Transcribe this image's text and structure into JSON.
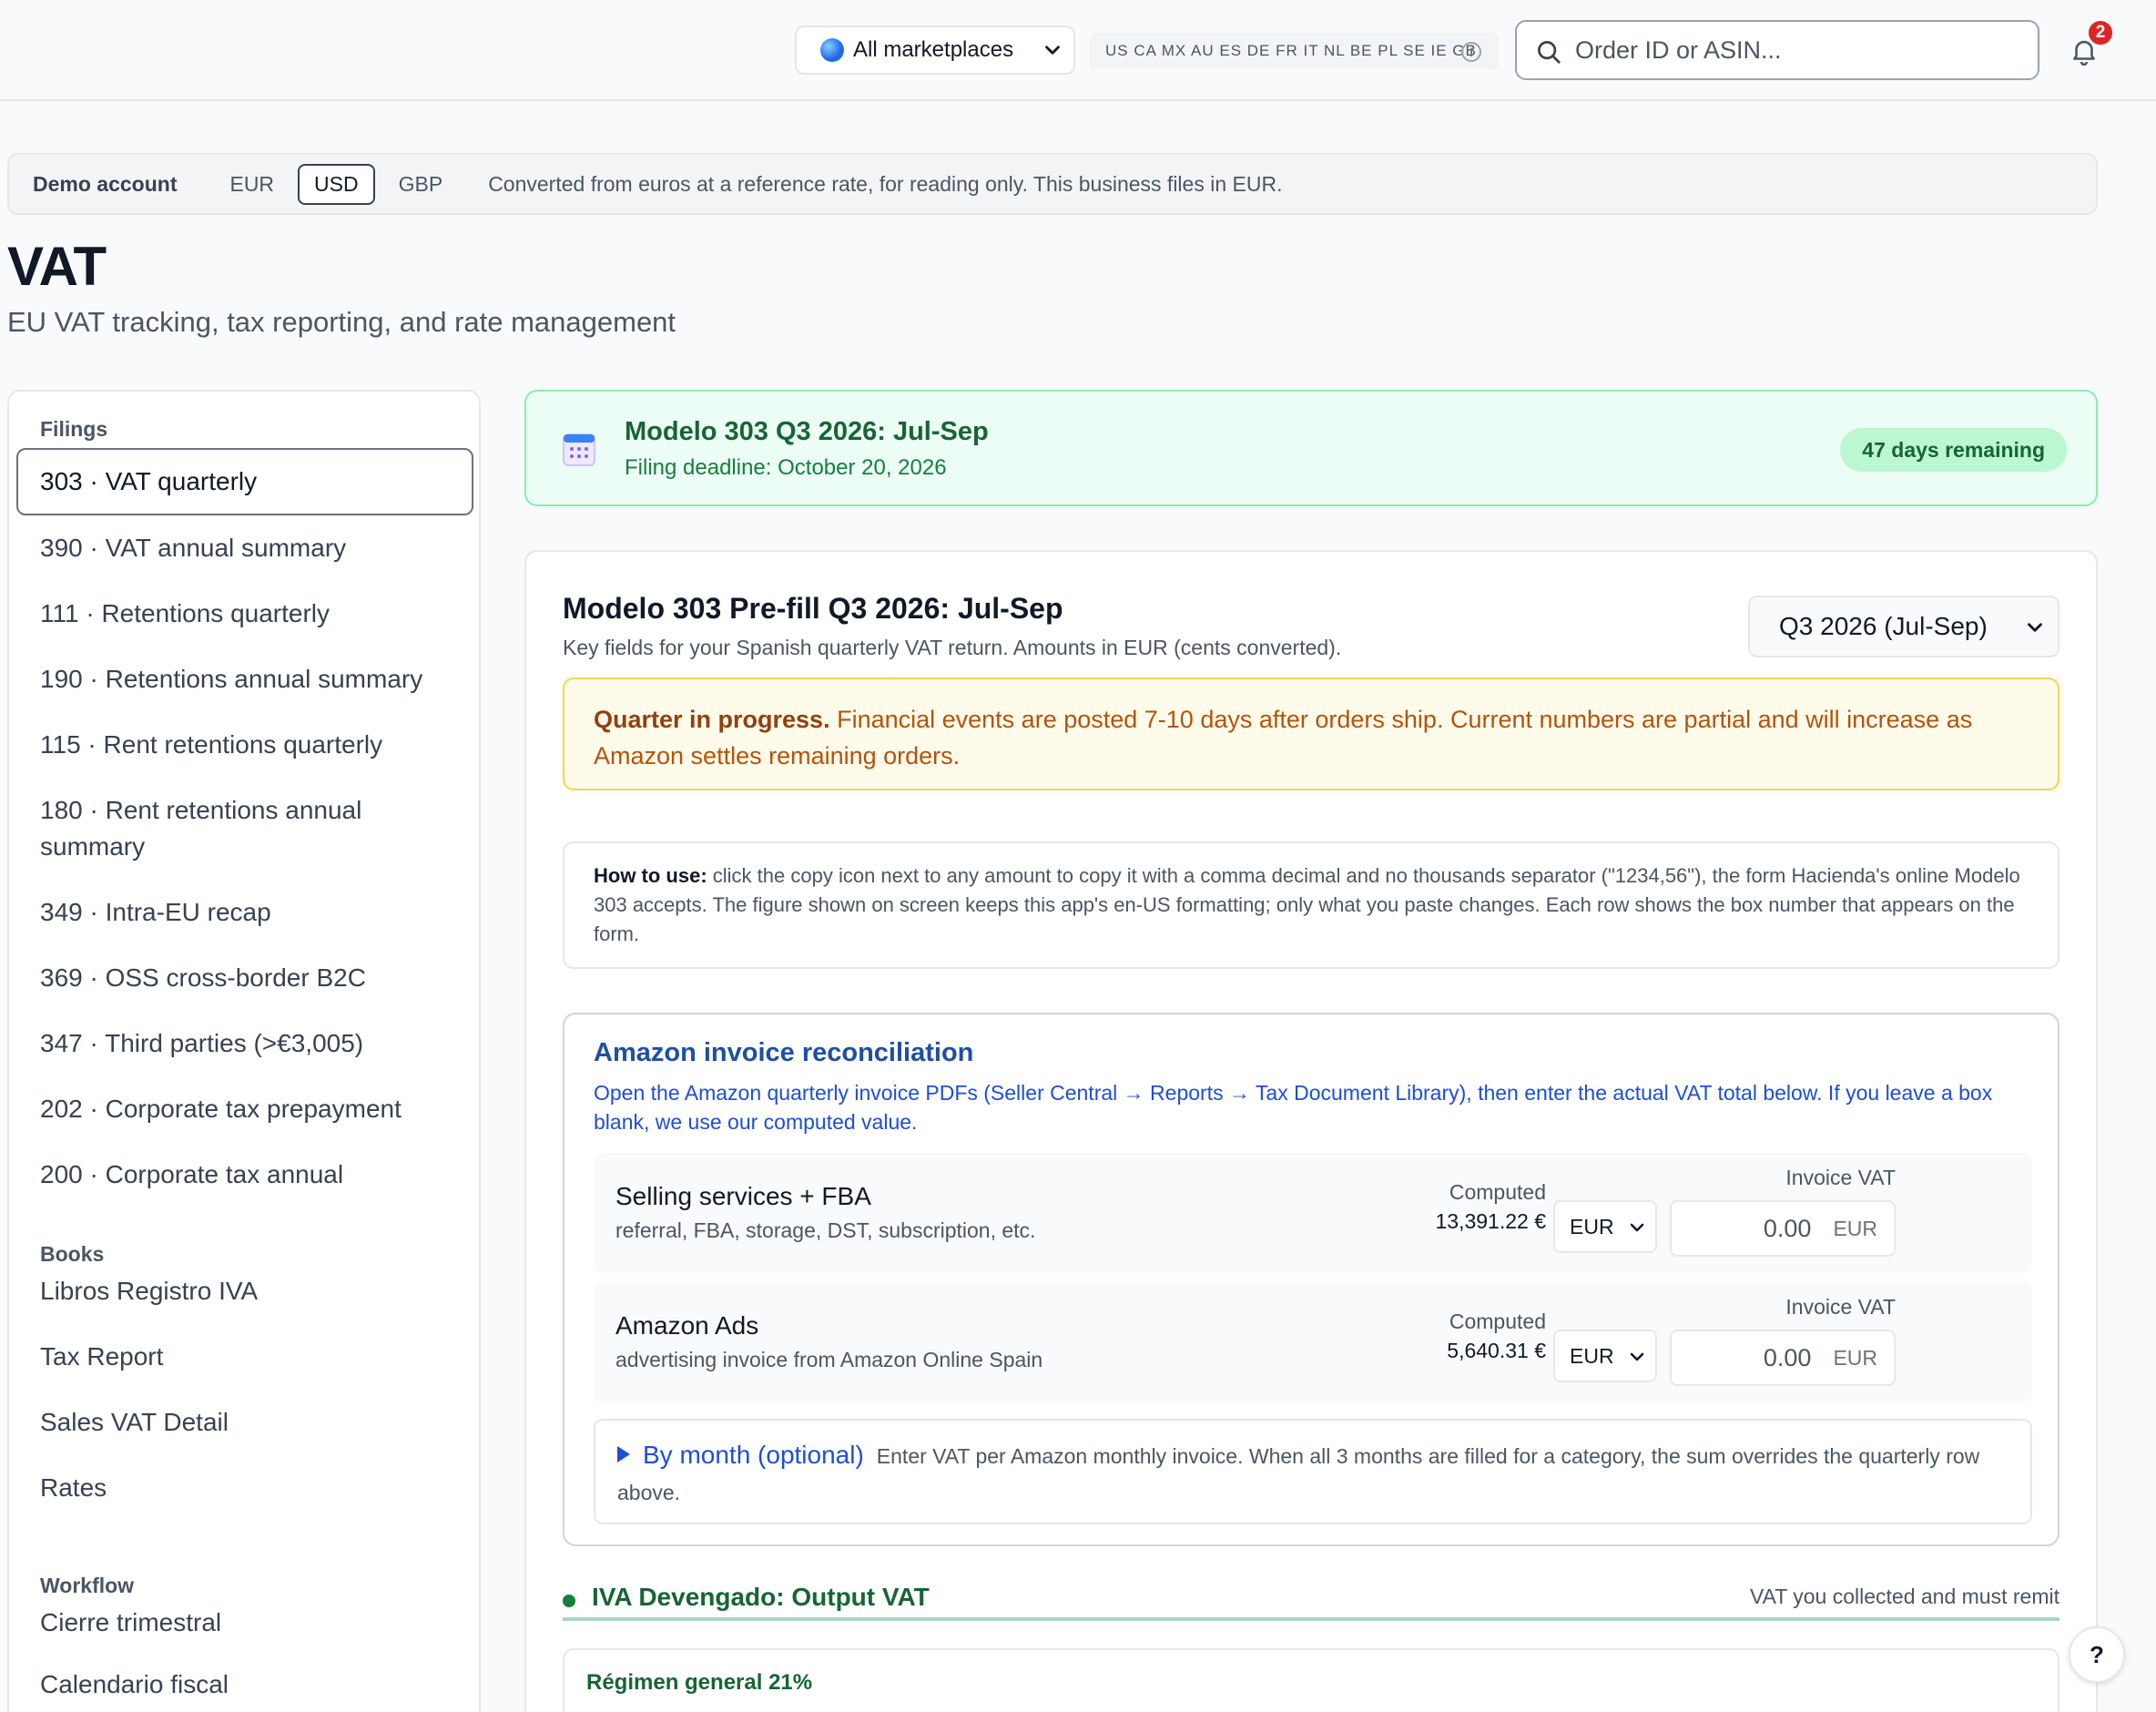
{
  "topbar": {
    "marketplace_label": "All marketplaces",
    "countries": "US CA MX AU ES DE FR IT NL BE PL SE IE GB",
    "info_icon": "i",
    "search_placeholder": "Order ID or ASIN...",
    "notifications_count": "2"
  },
  "demo_bar": {
    "label": "Demo account",
    "currencies": [
      "EUR",
      "USD",
      "GBP"
    ],
    "active_currency": "USD",
    "note": "Converted from euros at a reference rate, for reading only. This business files in EUR."
  },
  "page": {
    "title": "VAT",
    "subtitle": "EU VAT tracking, tax reporting, and rate management"
  },
  "sidebar": {
    "filings_heading": "Filings",
    "filings": [
      "303 · VAT quarterly",
      "390 · VAT annual summary",
      "111 · Retentions quarterly",
      "190 · Retentions annual summary",
      "115 · Rent retentions quarterly",
      "180 · Rent retentions annual summary",
      "349 · Intra-EU recap",
      "369 · OSS cross-border B2C",
      "347 · Third parties (>€3,005)",
      "202 · Corporate tax prepayment",
      "200 · Corporate tax annual"
    ],
    "books_heading": "Books",
    "books": [
      "Libros Registro IVA",
      "Tax Report",
      "Sales VAT Detail",
      "Rates"
    ],
    "workflow_heading": "Workflow",
    "workflow": [
      "Cierre trimestral",
      "Calendario fiscal"
    ]
  },
  "deadline": {
    "title": "Modelo 303 Q3 2026: Jul-Sep",
    "subtitle": "Filing deadline: October 20, 2026",
    "days_remaining": "47 days remaining"
  },
  "prefill": {
    "title": "Modelo 303 Pre-fill Q3 2026: Jul-Sep",
    "subtitle": "Key fields for your Spanish quarterly VAT return. Amounts in EUR (cents converted).",
    "quarter_selected": "Q3 2026 (Jul-Sep)",
    "warning_bold": "Quarter in progress.",
    "warning_text": " Financial events are posted 7-10 days after orders ship. Current numbers are partial and will increase as Amazon settles remaining orders.",
    "howto_bold": "How to use:",
    "howto_text": " click the copy icon next to any amount to copy it with a comma decimal and no thousands separator (\"1234,56\"), the form Hacienda's online Modelo 303 accepts. The figure shown on screen keeps this app's en-US formatting; only what you paste changes. Each row shows the box number that appears on the form."
  },
  "reconciliation": {
    "title": "Amazon invoice reconciliation",
    "description": "Open the Amazon quarterly invoice PDFs (Seller Central → Reports → Tax Document Library), then enter the actual VAT total below. If you leave a box blank, we use our computed value.",
    "computed_label": "Computed",
    "invoice_label": "Invoice VAT",
    "rows": [
      {
        "name": "Selling services + FBA",
        "desc": "referral, FBA, storage, DST, subscription, etc.",
        "computed": "13,391.22 €",
        "currency": "EUR",
        "invoice_placeholder": "0.00",
        "invoice_unit": "EUR"
      },
      {
        "name": "Amazon Ads",
        "desc": "advertising invoice from Amazon Online Spain",
        "computed": "5,640.31 €",
        "currency": "EUR",
        "invoice_placeholder": "0.00",
        "invoice_unit": "EUR"
      }
    ],
    "by_month_title": "By month (optional)",
    "by_month_text": "Enter VAT per Amazon monthly invoice. When all 3 months are filled for a category, the sum overrides the quarterly row above."
  },
  "output_vat": {
    "title": "IVA Devengado: Output VAT",
    "note": "VAT you collected and must remit",
    "regime_title": "Régimen general 21%"
  },
  "help": {
    "label": "?"
  },
  "colors": {
    "accent_green": "#166534",
    "accent_blue": "#1d4ed8",
    "warning": "#b45309",
    "badge_red": "#dc2626"
  }
}
